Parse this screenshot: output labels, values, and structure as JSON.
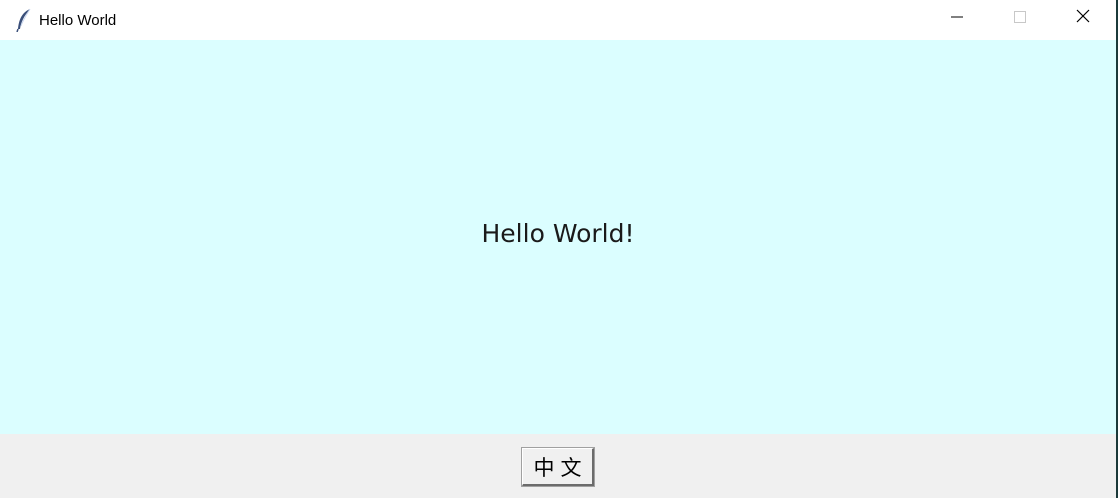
{
  "window": {
    "title": "Hello World",
    "app_icon": "feather-icon",
    "controls": {
      "minimize_icon": "minimize-icon",
      "maximize_icon": "maximize-icon",
      "close_icon": "close-icon"
    }
  },
  "content": {
    "background_color": "#dbfeff",
    "label": "Hello World!"
  },
  "footer": {
    "language_button_label": "中文"
  }
}
